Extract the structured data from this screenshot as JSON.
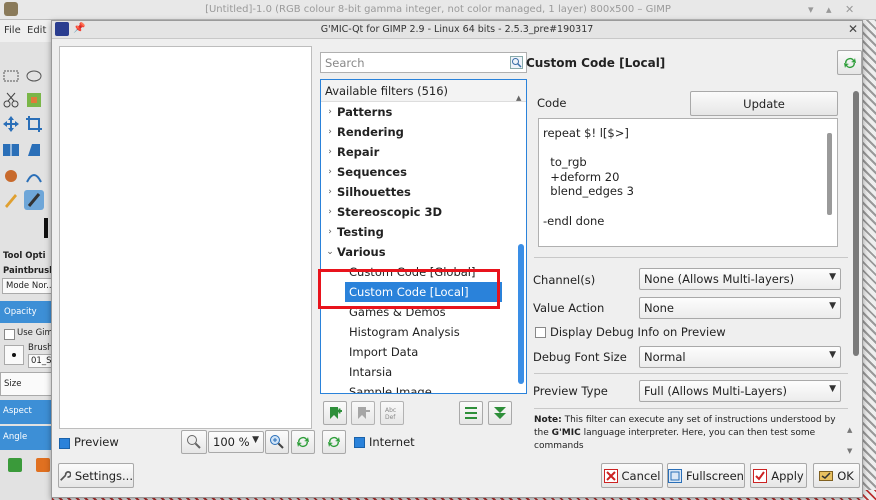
{
  "gimp": {
    "title": "[Untitled]-1.0 (RGB colour 8-bit gamma integer, not color managed, 1 layer) 800x500 – GIMP",
    "menu": [
      "File",
      "Edit"
    ],
    "tool_options_label": "Tool Opti",
    "tool_name": "Paintbrush",
    "mode_label": "Mode Nor...",
    "opacity_label": "Opacity",
    "use_gimp_label": "Use Gimp",
    "brush_label": "Brush",
    "brush_value": "01_S",
    "size_label": "Size",
    "aspect_label": "Aspect",
    "angle_label": "Angle"
  },
  "dialog": {
    "title": "G'MIC-Qt for GIMP 2.9 - Linux 64 bits - 2.5.3_pre#190317",
    "preview_label": "Preview",
    "zoom_value": "100 %",
    "settings_label": "Settings...",
    "internet_label": "Internet",
    "search_placeholder": "Search",
    "filters_header": "Available filters (516)",
    "tree": [
      {
        "label": "Patterns",
        "type": "cat",
        "expanded": false
      },
      {
        "label": "Rendering",
        "type": "cat",
        "expanded": false
      },
      {
        "label": "Repair",
        "type": "cat",
        "expanded": false
      },
      {
        "label": "Sequences",
        "type": "cat",
        "expanded": false
      },
      {
        "label": "Silhouettes",
        "type": "cat",
        "expanded": false
      },
      {
        "label": "Stereoscopic 3D",
        "type": "cat",
        "expanded": false
      },
      {
        "label": "Testing",
        "type": "cat",
        "expanded": false
      },
      {
        "label": "Various",
        "type": "cat",
        "expanded": true
      },
      {
        "label": "Custom Code [Global]",
        "type": "leaf"
      },
      {
        "label": "Custom Code [Local]",
        "type": "leaf",
        "selected": true
      },
      {
        "label": "Games & Demos",
        "type": "leaf"
      },
      {
        "label": "Histogram Analysis",
        "type": "leaf"
      },
      {
        "label": "Import Data",
        "type": "leaf"
      },
      {
        "label": "Intarsia",
        "type": "leaf"
      },
      {
        "label": "Sample Image",
        "type": "leaf"
      }
    ],
    "filter_name": "Custom Code [Local]",
    "code_label": "Code",
    "update_label": "Update",
    "code_text": "repeat $! l[$>]\n\n  to_rgb\n  +deform 20\n  blend_edges 3\n\n-endl done",
    "params": {
      "channels_label": "Channel(s)",
      "channels_value": "None (Allows Multi-layers)",
      "value_action_label": "Value Action",
      "value_action_value": "None",
      "debug_label": "Display Debug Info on Preview",
      "debug_font_label": "Debug Font Size",
      "debug_font_value": "Normal",
      "preview_type_label": "Preview Type",
      "preview_type_value": "Full (Allows Multi-Layers)"
    },
    "note_prefix": "Note:",
    "note_text": " This filter can execute any set of instructions understood by the ",
    "note_gmic": "G'MIC",
    "note_text2": " language interpreter. Here, you can then test some commands",
    "buttons": {
      "cancel": "Cancel",
      "fullscreen": "Fullscreen",
      "apply": "Apply",
      "ok": "OK"
    },
    "icons": {
      "add_fave": "add-favorite-icon",
      "remove_fave": "remove-favorite-icon",
      "rename_fave": "rename-favorite-icon",
      "visibility": "filter-visibility-icon",
      "expand": "expand-all-icon",
      "refresh": "refresh-icon",
      "zoom_in": "zoom-in-icon",
      "zoom_reset": "zoom-reset-icon"
    },
    "colors": {
      "selection": "#2a82da",
      "highlight": "#e8131c",
      "refresh_green": "#2e9e3a"
    }
  }
}
